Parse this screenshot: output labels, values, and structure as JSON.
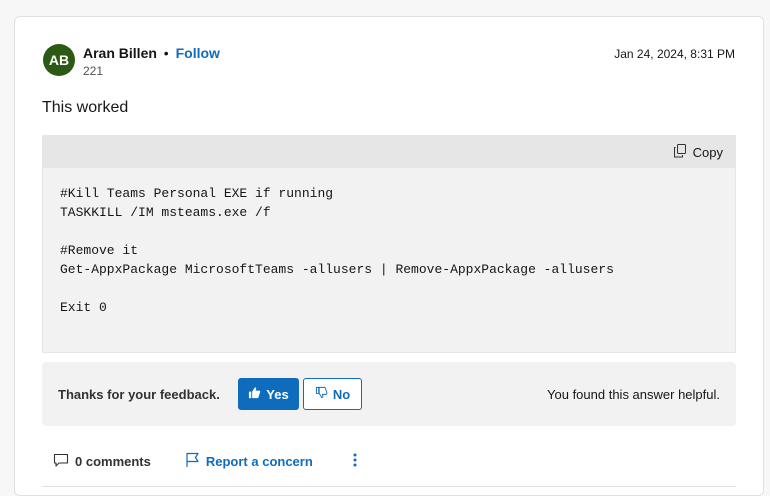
{
  "author": {
    "initials": "AB",
    "name": "Aran Billen",
    "separator": "•",
    "follow_label": "Follow",
    "reputation": "221",
    "avatar_color": "#2c5a14"
  },
  "post": {
    "date": "Jan 24, 2024, 8:31 PM",
    "body": "This worked"
  },
  "code": {
    "copy_label": "Copy",
    "content": "#Kill Teams Personal EXE if running\nTASKKILL /IM msteams.exe /f\n\n#Remove it\nGet-AppxPackage MicrosoftTeams -allusers | Remove-AppxPackage -allusers\n\nExit 0"
  },
  "feedback": {
    "label": "Thanks for your feedback.",
    "yes_label": "Yes",
    "no_label": "No",
    "status": "You found this answer helpful."
  },
  "actions": {
    "comments_label": "0 comments",
    "report_label": "Report a concern"
  },
  "colors": {
    "accent": "#0f6cbd",
    "code_bg": "#f2f2f2",
    "code_header_bg": "#e6e6e6"
  },
  "icons": {
    "copy": "copy-icon",
    "like": "thumbs-up-icon",
    "dislike": "thumbs-down-icon",
    "comment": "comment-icon",
    "flag": "flag-icon",
    "more": "more-vertical-icon"
  }
}
